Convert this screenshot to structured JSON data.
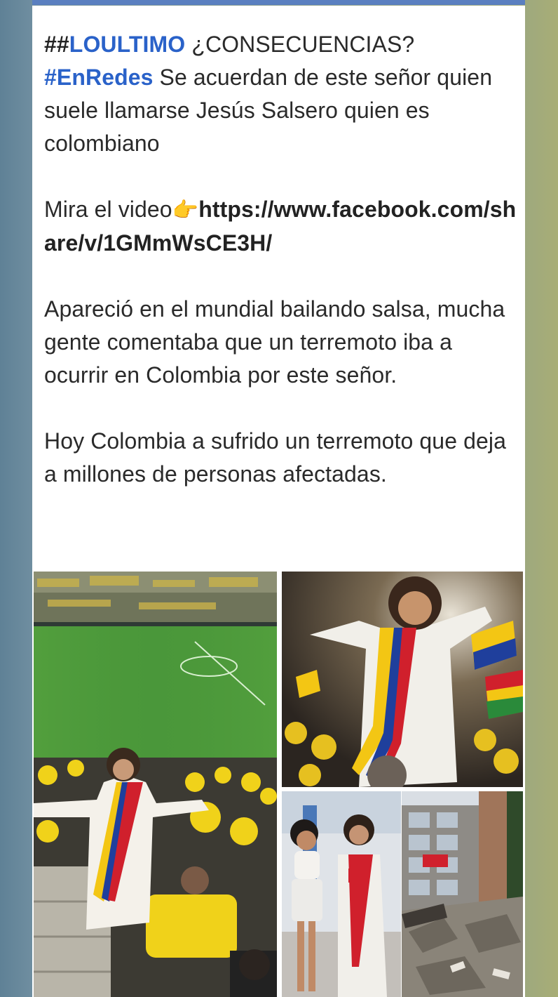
{
  "post": {
    "line1_hashtag_prefix": "##",
    "line1_hashtag": "LOULTIMO",
    "line1_text": " ¿CONSECUENCIAS?",
    "line2_hashtag": "#EnRedes",
    "line2_text": " Se acuerdan de este señor quien suele llamarse Jesús Salsero quien es colombiano",
    "video_prefix": "Mira el video",
    "video_emoji": "👉",
    "video_link": "https://www.facebook.com/share/v/1GMmWsCE3H/",
    "paragraph_2": "Apareció en el mundial bailando salsa, mucha gente comentaba que un terremoto iba a ocurrir en Colombia por este señor.",
    "paragraph_3": "Hoy Colombia a sufrido un terremoto que deja a millones de personas afectadas."
  },
  "colors": {
    "hashtag": "#2a62c9",
    "card": "#ffffff",
    "flag_yellow": "#f3c614",
    "flag_blue": "#1f3f9c",
    "flag_red": "#d0202c"
  },
  "images": [
    {
      "name": "stadium-photo-icon"
    },
    {
      "name": "ai-dancing-figure-photo-icon"
    },
    {
      "name": "couple-photo-icon"
    },
    {
      "name": "collapsed-building-photo-icon"
    }
  ]
}
